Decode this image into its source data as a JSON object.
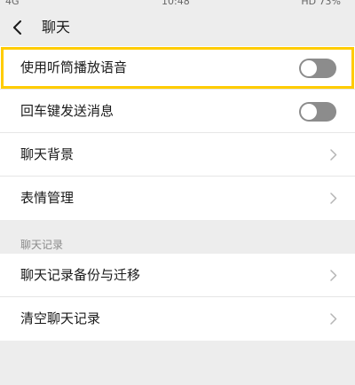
{
  "status_bar": {
    "left": "4G",
    "time": "10:48",
    "right": "HD 73%"
  },
  "nav": {
    "title": "聊天"
  },
  "settings": [
    {
      "label": "使用听筒播放语音",
      "control": "toggle",
      "on": false,
      "highlighted": true
    },
    {
      "label": "回车键发送消息",
      "control": "toggle",
      "on": false
    },
    {
      "label": "聊天背景",
      "control": "chevron"
    },
    {
      "label": "表情管理",
      "control": "chevron"
    }
  ],
  "history_section": {
    "header": "聊天记录",
    "items": [
      {
        "label": "聊天记录备份与迁移",
        "control": "chevron"
      },
      {
        "label": "清空聊天记录",
        "control": "chevron"
      }
    ]
  },
  "colors": {
    "highlight_border": "#ffcc00",
    "toggle_off": "#8c8c8c",
    "background": "#ededed",
    "row_background": "#ffffff"
  },
  "icons": {
    "back": "chevron-left-icon",
    "row_arrow": "chevron-right-icon"
  }
}
